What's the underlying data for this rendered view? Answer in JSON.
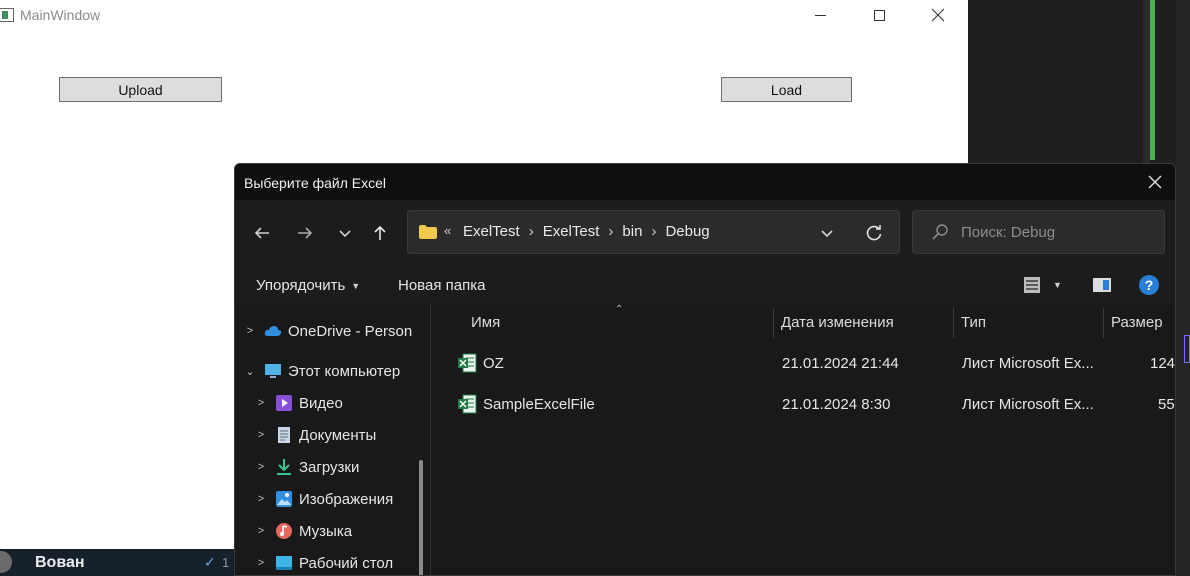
{
  "main_window": {
    "title": "MainWindow",
    "upload_label": "Upload",
    "load_label": "Load"
  },
  "chat": {
    "name": "Вован",
    "count": "1"
  },
  "dialog": {
    "title": "Выберите файл Excel",
    "breadcrumb_overflow": "«",
    "breadcrumbs": [
      "ExelTest",
      "ExelTest",
      "bin",
      "Debug"
    ],
    "search_placeholder": "Поиск: Debug",
    "commands": {
      "organize": "Упорядочить",
      "new_folder": "Новая папка",
      "help": "?"
    },
    "nav_tree": [
      {
        "label": "OneDrive - Person",
        "icon": "cloud-icon",
        "expanded": false
      },
      {
        "label": "Этот компьютер",
        "icon": "computer-icon",
        "expanded": true
      },
      {
        "label": "Видео",
        "icon": "video-icon",
        "expanded": false
      },
      {
        "label": "Документы",
        "icon": "document-icon",
        "expanded": false
      },
      {
        "label": "Загрузки",
        "icon": "download-icon",
        "expanded": false
      },
      {
        "label": "Изображения",
        "icon": "image-icon",
        "expanded": false
      },
      {
        "label": "Музыка",
        "icon": "music-icon",
        "expanded": false
      },
      {
        "label": "Рабочий стол",
        "icon": "desktop-icon",
        "expanded": false
      }
    ],
    "columns": [
      "Имя",
      "Дата изменения",
      "Тип",
      "Размер"
    ],
    "files": [
      {
        "name": "OZ",
        "modified": "21.01.2024 21:44",
        "type": "Лист Microsoft Ex...",
        "size": "124"
      },
      {
        "name": "SampleExcelFile",
        "modified": "21.01.2024 8:30",
        "type": "Лист Microsoft Ex...",
        "size": "55"
      }
    ]
  },
  "colors": {
    "accent_green": "#4caf50",
    "folder_yellow": "#f2c94c",
    "excel_green": "#1f7a45",
    "help_blue": "#2a7fd4"
  }
}
